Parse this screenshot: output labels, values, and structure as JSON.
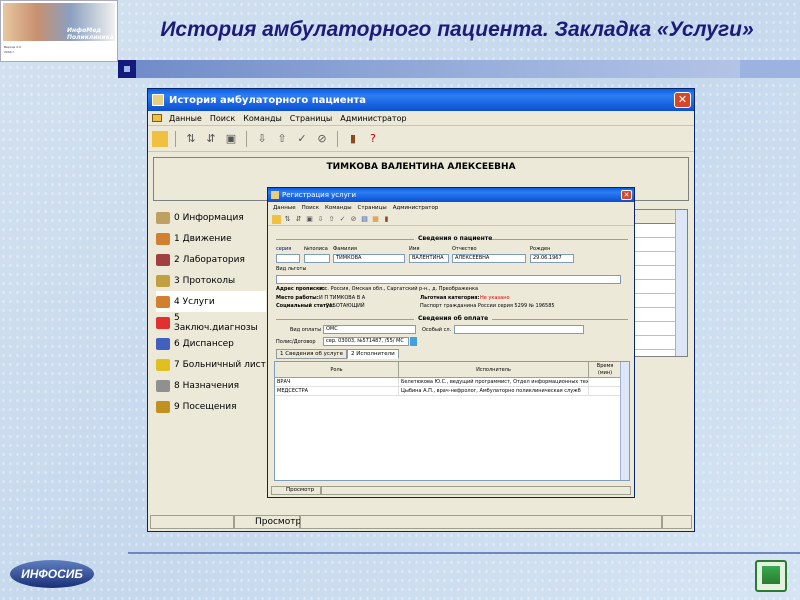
{
  "slide_title": "История амбулаторного пациента. Закладка «Услуги»",
  "logo": {
    "brand": "ИнфоМед Поликлиника",
    "line1": "Версия 2.0",
    "line2": "2004 г."
  },
  "footer": {
    "logo": "ИНФОСИБ",
    "home_icon": "home-icon"
  },
  "main_window": {
    "title": "История амбулаторного пациента",
    "menu": [
      "Данные",
      "Поиск",
      "Команды",
      "Страницы",
      "Администратор"
    ],
    "patient_name": "ТИМКОВА ВАЛЕНТИНА АЛЕКСЕЕВНА",
    "grid_header": "ель",
    "tabs": [
      {
        "label": "0 Информация",
        "color": "#c0a060"
      },
      {
        "label": "1 Движение",
        "color": "#d08030"
      },
      {
        "label": "2 Лаборатория",
        "color": "#a04040"
      },
      {
        "label": "3 Протоколы",
        "color": "#c0a040"
      },
      {
        "label": "4 Услуги",
        "color": "#d08030"
      },
      {
        "label": "5 Заключ.диагнозы",
        "color": "#e03030"
      },
      {
        "label": "6 Диспансер",
        "color": "#4060c0"
      },
      {
        "label": "7 Больничный лист",
        "color": "#e0c020"
      },
      {
        "label": "8 Назначения",
        "color": "#909090"
      },
      {
        "label": "9 Посещения",
        "color": "#c09020"
      }
    ],
    "status": "Просмотр"
  },
  "dialog": {
    "title": "Регистрация услуги",
    "menu": [
      "Данные",
      "Поиск",
      "Команды",
      "Страницы",
      "Администратор"
    ],
    "patient_section": "Сведения о пациенте",
    "labels": {
      "series": "серия",
      "policy": "№полиса",
      "surname": "Фамилия",
      "name": "Имя",
      "patronymic": "Отчество",
      "born": "Рожден",
      "benefit": "Вид льготы"
    },
    "values": {
      "surname": "ТИМКОВА",
      "name": "ВАЛЕНТИНА",
      "patronymic": "АЛЕКСЕЕВНА",
      "born": "29.06.1967"
    },
    "address_label": "Адрес прописки:",
    "address": "гос. Россия, Омская обл., Саргатский р-н., д. Преображенка",
    "work_label": "Место работы:",
    "work": "И П ТИМКОВА В А",
    "social_label": "Социальный статус:",
    "social": "РАБОТАЮЩИЙ",
    "benefit_cat_label": "Льготная категория:",
    "benefit_cat": "Не указано",
    "passport_label": "Паспорт гражданина России серия 5299 № 196585",
    "payment_section": "Сведения об оплате",
    "pay_type_label": "Вид оплаты",
    "pay_type": "ОМС",
    "special_label": "Особый сл.",
    "policy_label": "Полис/Договор",
    "policy_value": "сер. 03003, №571487, /55/ МС",
    "tabs": [
      "1 Сведения об услуге",
      "2 Исполнители"
    ],
    "table": {
      "headers": [
        "Роль",
        "Исполнитель",
        "Время (мин)"
      ],
      "rows": [
        [
          "ВРАЧ",
          "Белетюкова Ю.С., ведущий программист, Отдел информационных техн",
          ""
        ],
        [
          "МЕДСЕСТРА",
          "Цыбина А.П., врач-нефролог, Амбулаторно  поликлиническая служб",
          ""
        ]
      ]
    },
    "status": "Просмотр"
  }
}
